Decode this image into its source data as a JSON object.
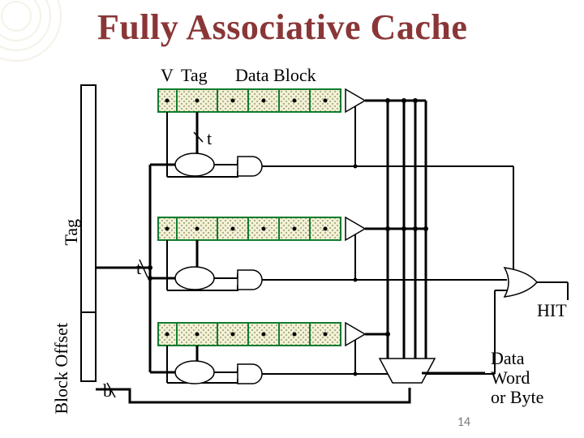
{
  "title": "Fully Associative Cache",
  "labels": {
    "V": "V",
    "Tag": "Tag",
    "DataBlock": "Data Block",
    "t_top": "t",
    "t_mid": "t",
    "b": "b",
    "HIT": "HIT",
    "DataOut": "Data\nWord\nor Byte",
    "TagRotated": "Tag",
    "BlockOffset": "Block\nOffset"
  },
  "comparator": "=",
  "slide_number": "14",
  "structure": {
    "type": "schematic",
    "topic": "Fully associative cache lookup",
    "cache_lines_shown": 3,
    "per_line_fields": [
      "Valid bit",
      "Tag",
      "Data block (4 words)"
    ],
    "address_fields": [
      "Tag (t bits)",
      "Block Offset (b bits)"
    ],
    "per_line_logic": [
      "t-bit comparator (tag match)",
      "AND gate (valid ∧ tag-match)",
      "tri-state data driver"
    ],
    "combine": "OR of all AND outputs → HIT",
    "data_select": "4:1 mux driven by block offset → Data Word or Byte"
  }
}
